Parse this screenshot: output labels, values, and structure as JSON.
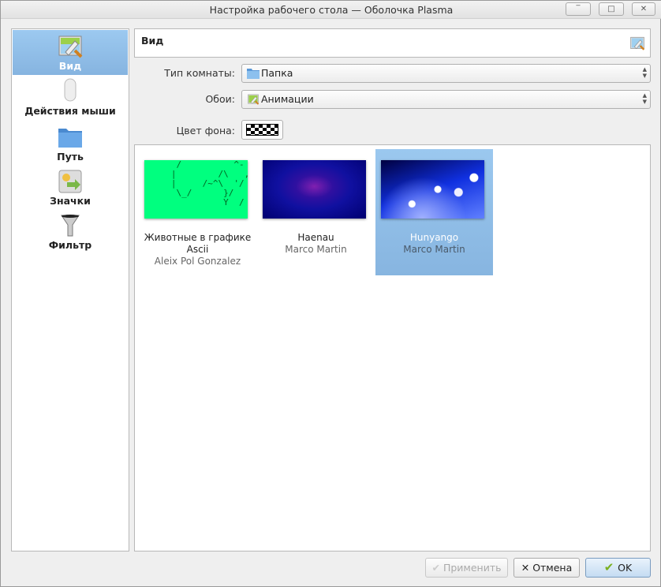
{
  "window": {
    "title": "Настройка рабочего стола — Оболочка Plasma",
    "buttons": [
      "‾",
      "□",
      "✕"
    ]
  },
  "sidebar": {
    "items": [
      {
        "label": "Вид",
        "icon": "wallpaper-brush-icon",
        "selected": true
      },
      {
        "label": "Действия мыши",
        "icon": "mouse-icon"
      },
      {
        "label": "Путь",
        "icon": "folder-icon"
      },
      {
        "label": "Значки",
        "icon": "icons-icon"
      },
      {
        "label": "Фильтр",
        "icon": "funnel-icon"
      }
    ]
  },
  "header": {
    "title": "Вид"
  },
  "form": {
    "layout_label": "Тип комнаты:",
    "layout_value": "Папка",
    "wallpaper_label": "Обои:",
    "wallpaper_value": "Анимации",
    "bgcolor_label": "Цвет фона:"
  },
  "wallpapers": [
    {
      "name": "Животные в графике Ascii",
      "author": "Aleix Pol Gonzalez",
      "art": "    /          ^-\n   |        /\\   ,\n   |     /~^\\  '/\n    \\_/      }/\n             Y  /"
    },
    {
      "name": "Haenau",
      "author": "Marco Martin"
    },
    {
      "name": "Hunyango",
      "author": "Marco Martin",
      "selected": true
    }
  ],
  "buttons": {
    "apply": "Применить",
    "cancel": "Отмена",
    "ok": "OK"
  },
  "colors": {
    "selection": "#8fbde8",
    "ascii_bg": "#00ff7f"
  }
}
